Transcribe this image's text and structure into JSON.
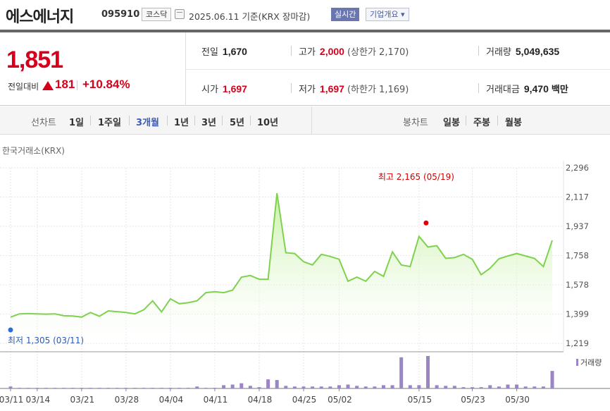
{
  "header": {
    "name": "에스에너지",
    "code": "095910",
    "market": "코스닥",
    "date_label": "2025.06.11  기준(KRX 장마감)",
    "realtime_button": "실시간",
    "company_button": "기업개요 ▾"
  },
  "quote": {
    "price": "1,851",
    "prev_label": "전일대비",
    "change": "181",
    "change_pct": "+10.84%",
    "prev_close_label": "전일",
    "prev_close": "1,670",
    "open_label": "시가",
    "open": "1,697",
    "high_label": "고가",
    "high": "2,000",
    "upper_limit": "(상한가 2,170)",
    "low_label": "저가",
    "low": "1,697",
    "lower_limit": "(하한가 1,169)",
    "volume_label": "거래량",
    "volume": "5,049,635",
    "value_label": "거래대금",
    "value": "9,470",
    "value_unit": "백만"
  },
  "tabs": {
    "line_label": "선차트",
    "periods": [
      "1일",
      "1주일",
      "3개월",
      "1년",
      "3년",
      "5년",
      "10년"
    ],
    "active": "3개월",
    "candle_label": "봉차트",
    "candles": [
      "일봉",
      "주봉",
      "월봉"
    ]
  },
  "colors": {
    "up": "#d6001c",
    "line": "#7ed24e",
    "area_top": "#c8f0a6",
    "volume": "#9a86c6",
    "low_dot": "#2a6ed8"
  },
  "chart_data": {
    "type": "area",
    "source_label": "한국거래소(KRX)",
    "y_ticks": [
      "2,296",
      "2,117",
      "1,937",
      "1,758",
      "1,578",
      "1,399",
      "1,219"
    ],
    "ylim": [
      1219,
      2296
    ],
    "x_tick_labels": [
      "03/11",
      "03/14",
      "03/21",
      "03/28",
      "04/04",
      "04/11",
      "04/18",
      "04/25",
      "05/02",
      "05/15",
      "05/23",
      "05/30"
    ],
    "x_tick_index": [
      0,
      3,
      8,
      13,
      18,
      23,
      28,
      33,
      37,
      46,
      52,
      57
    ],
    "price_values": [
      1380,
      1400,
      1402,
      1400,
      1398,
      1400,
      1388,
      1387,
      1380,
      1408,
      1385,
      1418,
      1413,
      1408,
      1400,
      1425,
      1480,
      1412,
      1492,
      1462,
      1468,
      1480,
      1530,
      1536,
      1530,
      1545,
      1625,
      1635,
      1612,
      1612,
      2140,
      1775,
      1770,
      1720,
      1700,
      1765,
      1752,
      1735,
      1600,
      1625,
      1600,
      1660,
      1630,
      1780,
      1700,
      1690,
      1875,
      1810,
      1818,
      1740,
      1745,
      1765,
      1735,
      1640,
      1680,
      1738,
      1755,
      1770,
      1755,
      1740,
      1690,
      1851
    ],
    "volume_values": [
      3,
      1,
      1,
      1,
      1,
      1,
      1,
      1,
      1,
      1,
      1,
      1,
      1,
      1,
      1,
      1,
      1,
      1,
      1,
      1,
      1,
      3,
      1,
      1,
      5,
      6,
      8,
      4,
      2,
      14,
      13,
      4,
      3,
      3,
      3,
      3,
      3,
      5,
      6,
      4,
      3,
      3,
      5,
      5,
      48,
      5,
      5,
      50,
      5,
      4,
      4,
      2,
      2,
      2,
      5,
      3,
      6,
      6,
      3,
      3,
      3,
      27
    ],
    "max_label": "최고 2,165 (05/19)",
    "max_value": 2165,
    "min_label": "최저  1,305 (03/11)",
    "min_value": 1305,
    "volume_legend": "거래량"
  }
}
